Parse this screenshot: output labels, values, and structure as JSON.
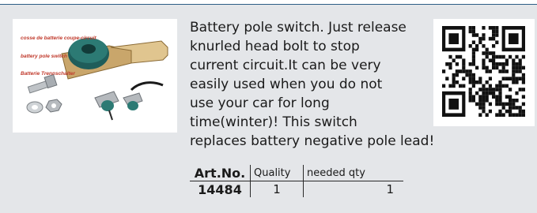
{
  "product": {
    "photo_caption": [
      "cosse de batterie coupe-circuit",
      "battery pole switch",
      "Batterie Trennschalter"
    ],
    "description_lines": [
      "Battery pole switch. Just release",
      "knurled head bolt to stop",
      "current circuit.It can be very",
      "easily used when you do not",
      "use your car for long",
      "time(winter)! This switch",
      "replaces battery negative pole lead!"
    ]
  },
  "table": {
    "headers": {
      "art_no": "Art.No.",
      "quality": "Quality",
      "needed_qty": "needed qty"
    },
    "values": {
      "art_no": "14484",
      "quality": "1",
      "needed_qty": "1"
    }
  },
  "colors": {
    "panel": "#e4e6e9",
    "rule": "#2c5d86",
    "caption": "#c0392b"
  },
  "icons": {
    "qr": "qr-code-icon"
  }
}
